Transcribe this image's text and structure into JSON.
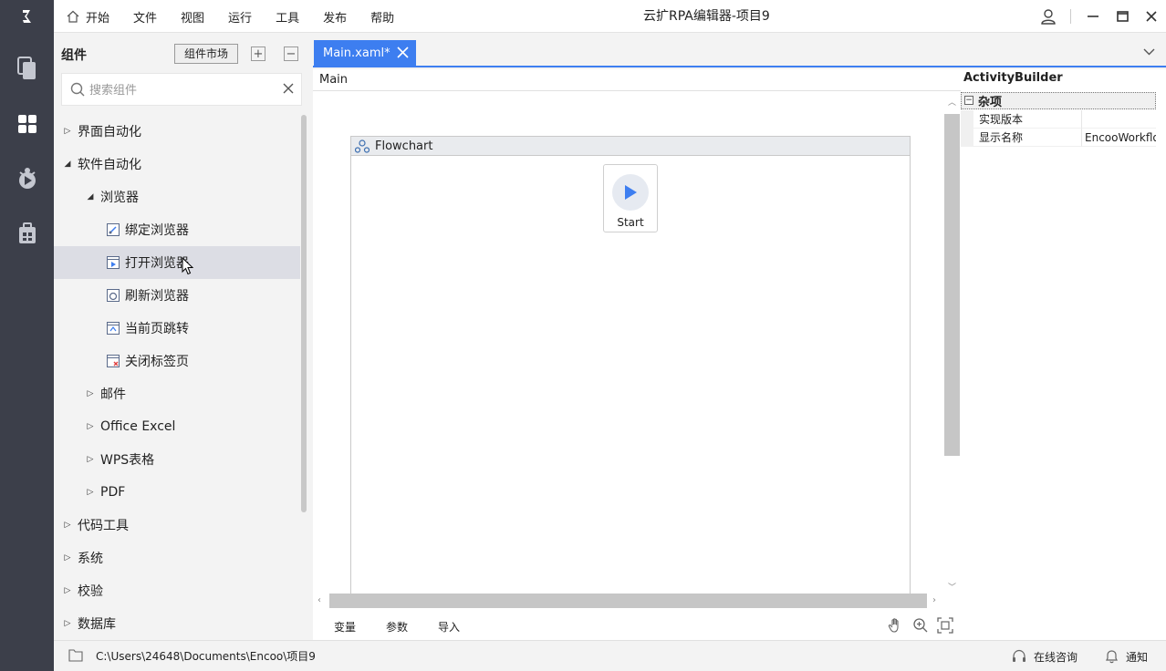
{
  "app": {
    "title": "云扩RPA编辑器-项目9",
    "menu": [
      "开始",
      "文件",
      "视图",
      "运行",
      "工具",
      "发布",
      "帮助"
    ]
  },
  "rail": {
    "icons": [
      "logo-icon",
      "files-icon",
      "components-icon",
      "debug-icon",
      "package-icon"
    ]
  },
  "components": {
    "title": "组件",
    "market_button": "组件市场",
    "expand_label": "+",
    "collapse_label": "−",
    "search_placeholder": "搜索组件",
    "tree": [
      {
        "label": "界面自动化",
        "expanded": false
      },
      {
        "label": "软件自动化",
        "expanded": true
      },
      {
        "label": "浏览器",
        "expanded": true
      },
      {
        "label": "绑定浏览器",
        "icon": "bind-browser-icon"
      },
      {
        "label": "打开浏览器",
        "icon": "open-browser-icon",
        "selected": true
      },
      {
        "label": "刷新浏览器",
        "icon": "refresh-browser-icon"
      },
      {
        "label": "当前页跳转",
        "icon": "navigate-icon"
      },
      {
        "label": "关闭标签页",
        "icon": "close-tab-icon"
      },
      {
        "label": "邮件",
        "expanded": false
      },
      {
        "label": "Office Excel",
        "expanded": false
      },
      {
        "label": "WPS表格",
        "expanded": false
      },
      {
        "label": "PDF",
        "expanded": false
      },
      {
        "label": "代码工具",
        "expanded": false
      },
      {
        "label": "系统",
        "expanded": false
      },
      {
        "label": "校验",
        "expanded": false
      },
      {
        "label": "数据库",
        "expanded": false
      }
    ]
  },
  "editor": {
    "tab_label": "Main.xaml*",
    "breadcrumb": "Main",
    "flowchart_title": "Flowchart",
    "start_label": "Start",
    "bottom_tabs": [
      "变量",
      "参数",
      "导入"
    ]
  },
  "properties": {
    "title": "ActivityBuilder",
    "category": "杂项",
    "rows": [
      {
        "name": "实现版本",
        "value": ""
      },
      {
        "name": "显示名称",
        "value": "EncooWorkflow"
      }
    ]
  },
  "status": {
    "path": "C:\\Users\\24648\\Documents\\Encoo\\项目9",
    "consult": "在线咨询",
    "notify": "通知"
  },
  "colors": {
    "rail": "#3c3f4a",
    "accent": "#3d7ef0",
    "selected_row": "#dcdde4"
  }
}
